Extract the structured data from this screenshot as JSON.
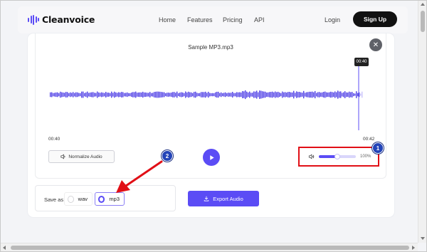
{
  "nav": {
    "brand": "Cleanvoice",
    "links": [
      "Home",
      "Features",
      "Pricing",
      "API"
    ],
    "login": "Login",
    "signup": "Sign Up"
  },
  "editor": {
    "filename": "Sample MP3.mp3",
    "playhead_time": "00:40",
    "start_time": "00:40",
    "end_time": "00:42",
    "normalize_label": "Normalize Audio",
    "volume_percent_label": "100%",
    "volume_level": 0.5
  },
  "save": {
    "label": "Save as",
    "options": [
      "wav",
      "mp3"
    ],
    "selected": "mp3"
  },
  "export_label": "Export Audio",
  "annotations": {
    "badge_1": "1",
    "badge_2": "2"
  },
  "colors": {
    "accent": "#5b4cf5",
    "highlight": "#e10f16",
    "badge": "#2344b8"
  }
}
